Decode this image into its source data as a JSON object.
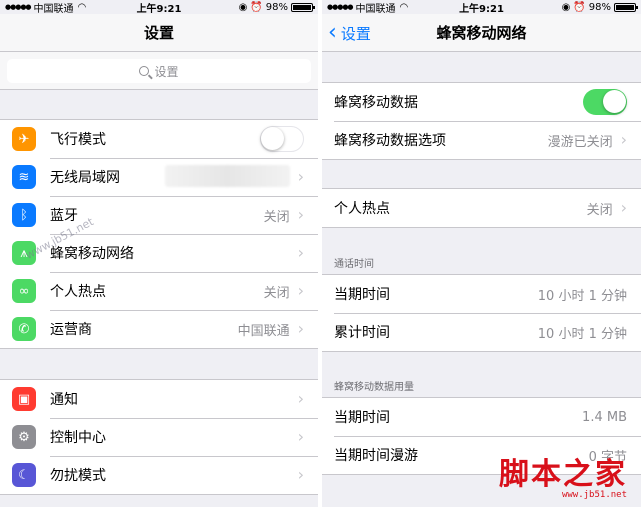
{
  "status": {
    "carrier": "中国联通",
    "time": "上午9:21",
    "battery": "98%"
  },
  "left": {
    "title": "设置",
    "search_placeholder": "设置",
    "group1": [
      {
        "label": "飞行模式",
        "icon": "airplane-icon",
        "color": "#ff9500",
        "control": "toggle-off"
      },
      {
        "label": "无线局域网",
        "icon": "wifi-icon",
        "color": "#0a7aff",
        "value": ""
      },
      {
        "label": "蓝牙",
        "icon": "bluetooth-icon",
        "color": "#0a7aff",
        "value": "关闭"
      },
      {
        "label": "蜂窝移动网络",
        "icon": "cellular-icon",
        "color": "#4cd964",
        "value": ""
      },
      {
        "label": "个人热点",
        "icon": "hotspot-icon",
        "color": "#4cd964",
        "value": "关闭"
      },
      {
        "label": "运营商",
        "icon": "phone-icon",
        "color": "#4cd964",
        "value": "中国联通"
      }
    ],
    "group2": [
      {
        "label": "通知",
        "icon": "notifications-icon",
        "color": "#ff3b30"
      },
      {
        "label": "控制中心",
        "icon": "control-center-icon",
        "color": "#8e8e93"
      },
      {
        "label": "勿扰模式",
        "icon": "moon-icon",
        "color": "#5856d6"
      }
    ]
  },
  "right": {
    "back_label": "设置",
    "title": "蜂窝移动网络",
    "group1": [
      {
        "label": "蜂窝移动数据",
        "control": "toggle-on"
      },
      {
        "label": "蜂窝移动数据选项",
        "value": "漫游已关闭"
      }
    ],
    "group2": [
      {
        "label": "个人热点",
        "value": "关闭"
      }
    ],
    "call_time_header": "通话时间",
    "call_time": [
      {
        "label": "当期时间",
        "value": "10 小时 1 分钟"
      },
      {
        "label": "累计时间",
        "value": "10 小时 1 分钟"
      }
    ],
    "data_usage_header": "蜂窝移动数据用量",
    "data_usage": [
      {
        "label": "当期时间",
        "value": "1.4 MB"
      },
      {
        "label": "当期时间漫游",
        "value": "0 字节"
      }
    ]
  },
  "watermark": "www.jb51.net",
  "logo": {
    "text": "脚本之家",
    "url": "www.jb51.net"
  },
  "colors": {
    "accent": "#0a7aff",
    "toggle_on": "#4cd964",
    "logo_red": "#d8101a"
  }
}
